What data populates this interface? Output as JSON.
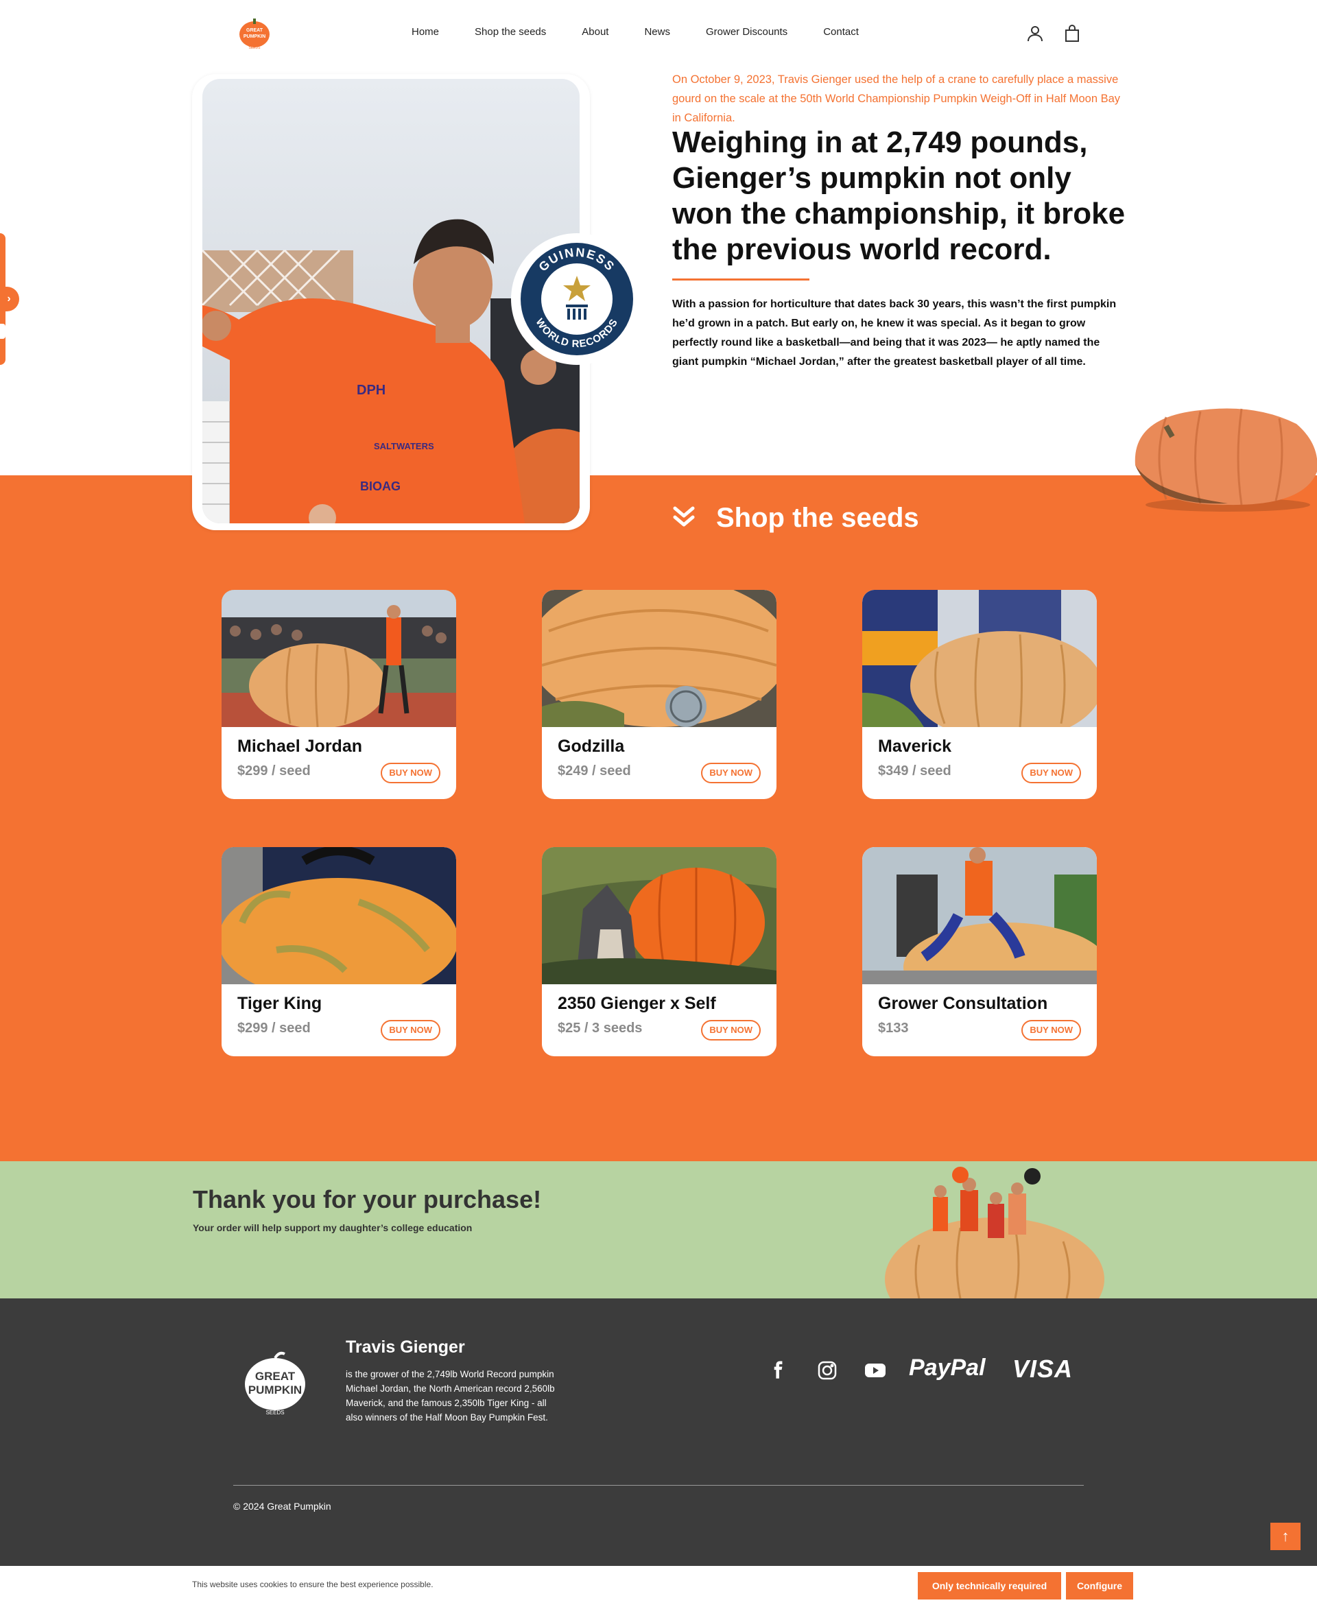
{
  "header": {
    "logo_text_1": "GREAT",
    "logo_text_2": "PUMPKIN",
    "logo_text_3": "SEEDS",
    "nav": [
      "Home",
      "Shop the seeds",
      "About",
      "News",
      "Grower Discounts",
      "Contact"
    ]
  },
  "hero": {
    "intro": "On October 9, 2023, Travis Gienger used the help of a crane to carefully place a massive gourd on the scale at the 50th World Championship Pumpkin Weigh-Off in Half Moon Bay in California.",
    "title": "Weighing in at 2,749 pounds, Gienger’s pumpkin not only won the championship, it broke the previous world record.",
    "body": "With a passion for horticulture that dates back 30 years, this wasn’t the first pumpkin he’d grown in a patch. But early on, he knew it was special. As it began to grow perfectly round like a basketball—and being that it was 2023— he aptly named the giant pumpkin “Michael Jordan,” after the greatest basketball player of all time.",
    "badge_top": "GUINNESS",
    "badge_bottom": "WORLD RECORDS"
  },
  "shop": {
    "title": "Shop the seeds",
    "products": [
      {
        "name": "Michael Jordan",
        "price": "$299 / seed",
        "button": "BUY NOW"
      },
      {
        "name": "Godzilla",
        "price": "$249 / seed",
        "button": "BUY NOW"
      },
      {
        "name": "Maverick",
        "price": "$349 / seed",
        "button": "BUY NOW"
      },
      {
        "name": "Tiger King",
        "price": "$299 / seed",
        "button": "BUY NOW"
      },
      {
        "name": "2350 Gienger x Self",
        "price": "$25 / 3 seeds",
        "button": "BUY NOW"
      },
      {
        "name": "Grower Consultation",
        "price": "$133",
        "button": "BUY NOW"
      }
    ]
  },
  "thanks": {
    "title": "Thank you for your purchase!",
    "subtitle": "Your order will help support my daughter’s college education"
  },
  "footer": {
    "name": "Travis Gienger",
    "description": "is the grower of the 2,749lb World Record pumpkin Michael Jordan, the North American record 2,560lb Maverick, and the famous 2,350lb Tiger King - all also winners of the Half Moon Bay Pumpkin Fest.",
    "paypal": "PayPal",
    "visa": "VISA",
    "copyright": "© 2024 Great Pumpkin",
    "to_top": "↑"
  },
  "cookie": {
    "text": "This website uses cookies to ensure the best experience possible.",
    "btn_required": "Only technically required",
    "btn_configure": "Configure"
  },
  "colors": {
    "accent": "#f47232",
    "green_band": "#b7d3a1",
    "footer_bg": "#3c3c3c"
  }
}
